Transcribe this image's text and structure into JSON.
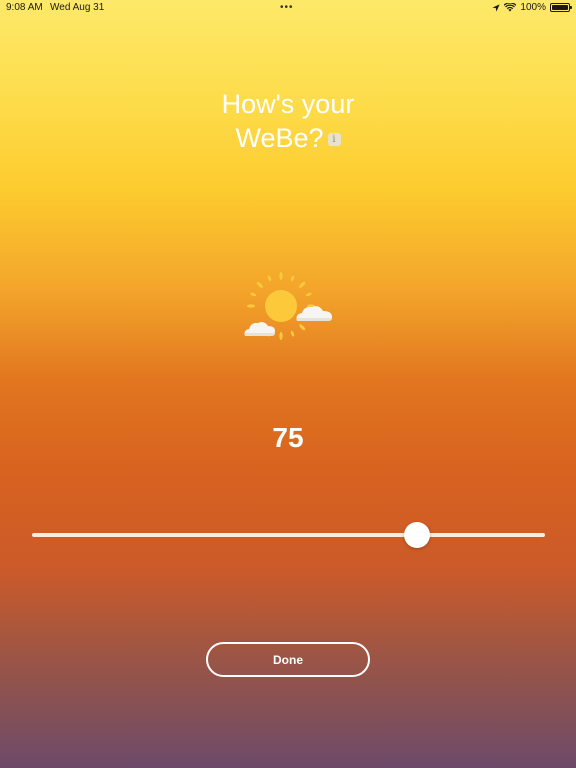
{
  "status_bar": {
    "time": "9:08 AM",
    "date": "Wed Aug 31",
    "battery_percent": "100%",
    "icons": [
      "location-arrow-icon",
      "wifi-icon",
      "battery-icon"
    ]
  },
  "title": {
    "line1": "How's your",
    "line2": "WeBe?",
    "info_glyph": "i"
  },
  "weather_icon": "sun-behind-clouds-icon",
  "wellbeing": {
    "value": "75",
    "slider_fraction": 0.75
  },
  "done_label": "Done",
  "colors": {
    "text": "#ffffff",
    "gradient_top": "#fde969",
    "gradient_middle": "#e2761f",
    "gradient_bottom": "#6d4a6a",
    "sun": "#fcc93a",
    "cloud": "#f7f5f1"
  }
}
